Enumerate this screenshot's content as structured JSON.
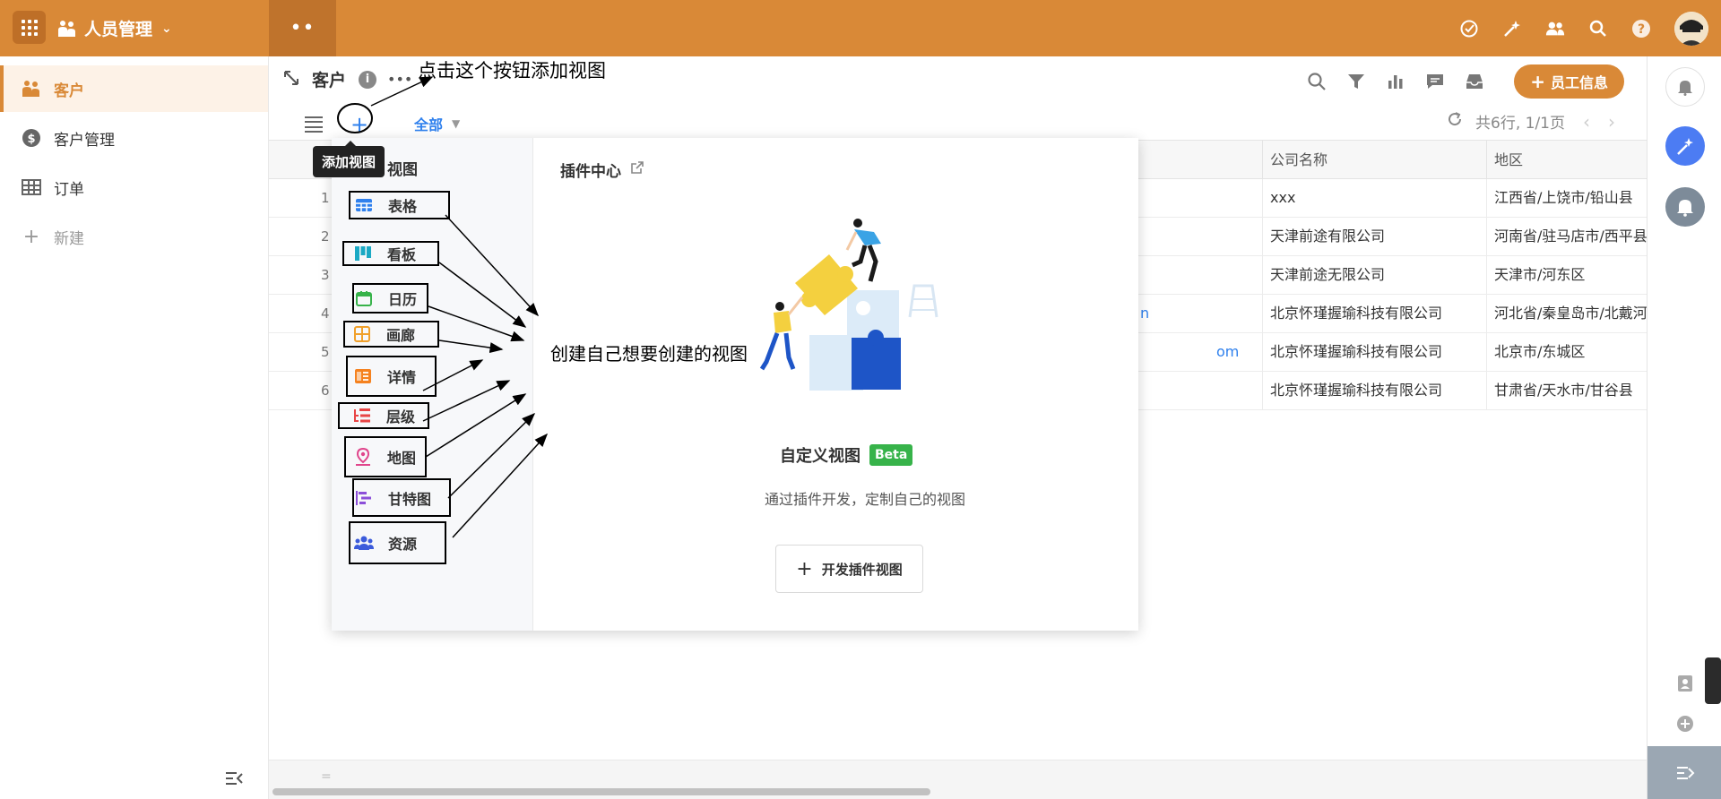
{
  "topbar": {
    "app_title": "人员管理",
    "colors": {
      "bar": "#D98937",
      "accent": "#2F80ED"
    },
    "icons": [
      "apps-grid-icon",
      "people-icon",
      "chevron-down-icon",
      "task-check-icon",
      "magic-sparkle-icon",
      "contacts-icon",
      "search-icon",
      "help-icon",
      "avatar"
    ]
  },
  "sidebar": {
    "items": [
      {
        "label": "客户",
        "icon": "people-icon",
        "active": true
      },
      {
        "label": "客户管理",
        "icon": "dollar-icon",
        "active": false
      },
      {
        "label": "订单",
        "icon": "table-icon",
        "active": false
      }
    ],
    "new_label": "新建"
  },
  "header": {
    "title": "客户",
    "annotation": "点击这个按钮添加视图",
    "add_staff_label": "员工信息",
    "tools": [
      "search-icon",
      "filter-icon",
      "chart-icon",
      "comment-icon",
      "inbox-icon"
    ]
  },
  "tabs": {
    "all_label": "全部",
    "tooltip": "添加视图"
  },
  "pager": {
    "text": "共6行, 1/1页"
  },
  "table": {
    "columns": [
      "公司名称",
      "地区"
    ],
    "rows": [
      {
        "num": "1",
        "company": "xxx",
        "region": "江西省/上饶市/铅山县",
        "link": ""
      },
      {
        "num": "2",
        "company": "天津前途有限公司",
        "region": "河南省/驻马店市/西平县",
        "link": ""
      },
      {
        "num": "3",
        "company": "天津前途无限公司",
        "region": "天津市/河东区",
        "link": ""
      },
      {
        "num": "4",
        "company": "北京怀瑾握瑜科技有限公司",
        "region": "河北省/秦皇岛市/北戴河",
        "link": "n"
      },
      {
        "num": "5",
        "company": "北京怀瑾握瑜科技有限公司",
        "region": "北京市/东城区",
        "link": "om"
      },
      {
        "num": "6",
        "company": "北京怀瑾握瑜科技有限公司",
        "region": "甘肃省/天水市/甘谷县",
        "link": ""
      }
    ]
  },
  "popup": {
    "views_heading": "视图",
    "views": [
      {
        "label": "表格",
        "icon": "grid-table-icon",
        "color": "#2F80ED"
      },
      {
        "label": "看板",
        "icon": "kanban-icon",
        "color": "#1BA9C4"
      },
      {
        "label": "日历",
        "icon": "calendar-icon",
        "color": "#37B34A"
      },
      {
        "label": "画廊",
        "icon": "gallery-icon",
        "color": "#F0A02B"
      },
      {
        "label": "详情",
        "icon": "detail-icon",
        "color": "#F58220"
      },
      {
        "label": "层级",
        "icon": "hierarchy-icon",
        "color": "#E84545"
      },
      {
        "label": "地图",
        "icon": "map-pin-icon",
        "color": "#E0468C"
      },
      {
        "label": "甘特图",
        "icon": "gantt-icon",
        "color": "#8C4FD9"
      },
      {
        "label": "资源",
        "icon": "resource-icon",
        "color": "#3B5BDB"
      }
    ],
    "plugin_center": "插件中心",
    "annotation": "创建自己想要创建的视图",
    "custom_view_title": "自定义视图",
    "beta": "Beta",
    "custom_view_desc": "通过插件开发，定制自己的视图",
    "dev_button": "开发插件视图"
  }
}
